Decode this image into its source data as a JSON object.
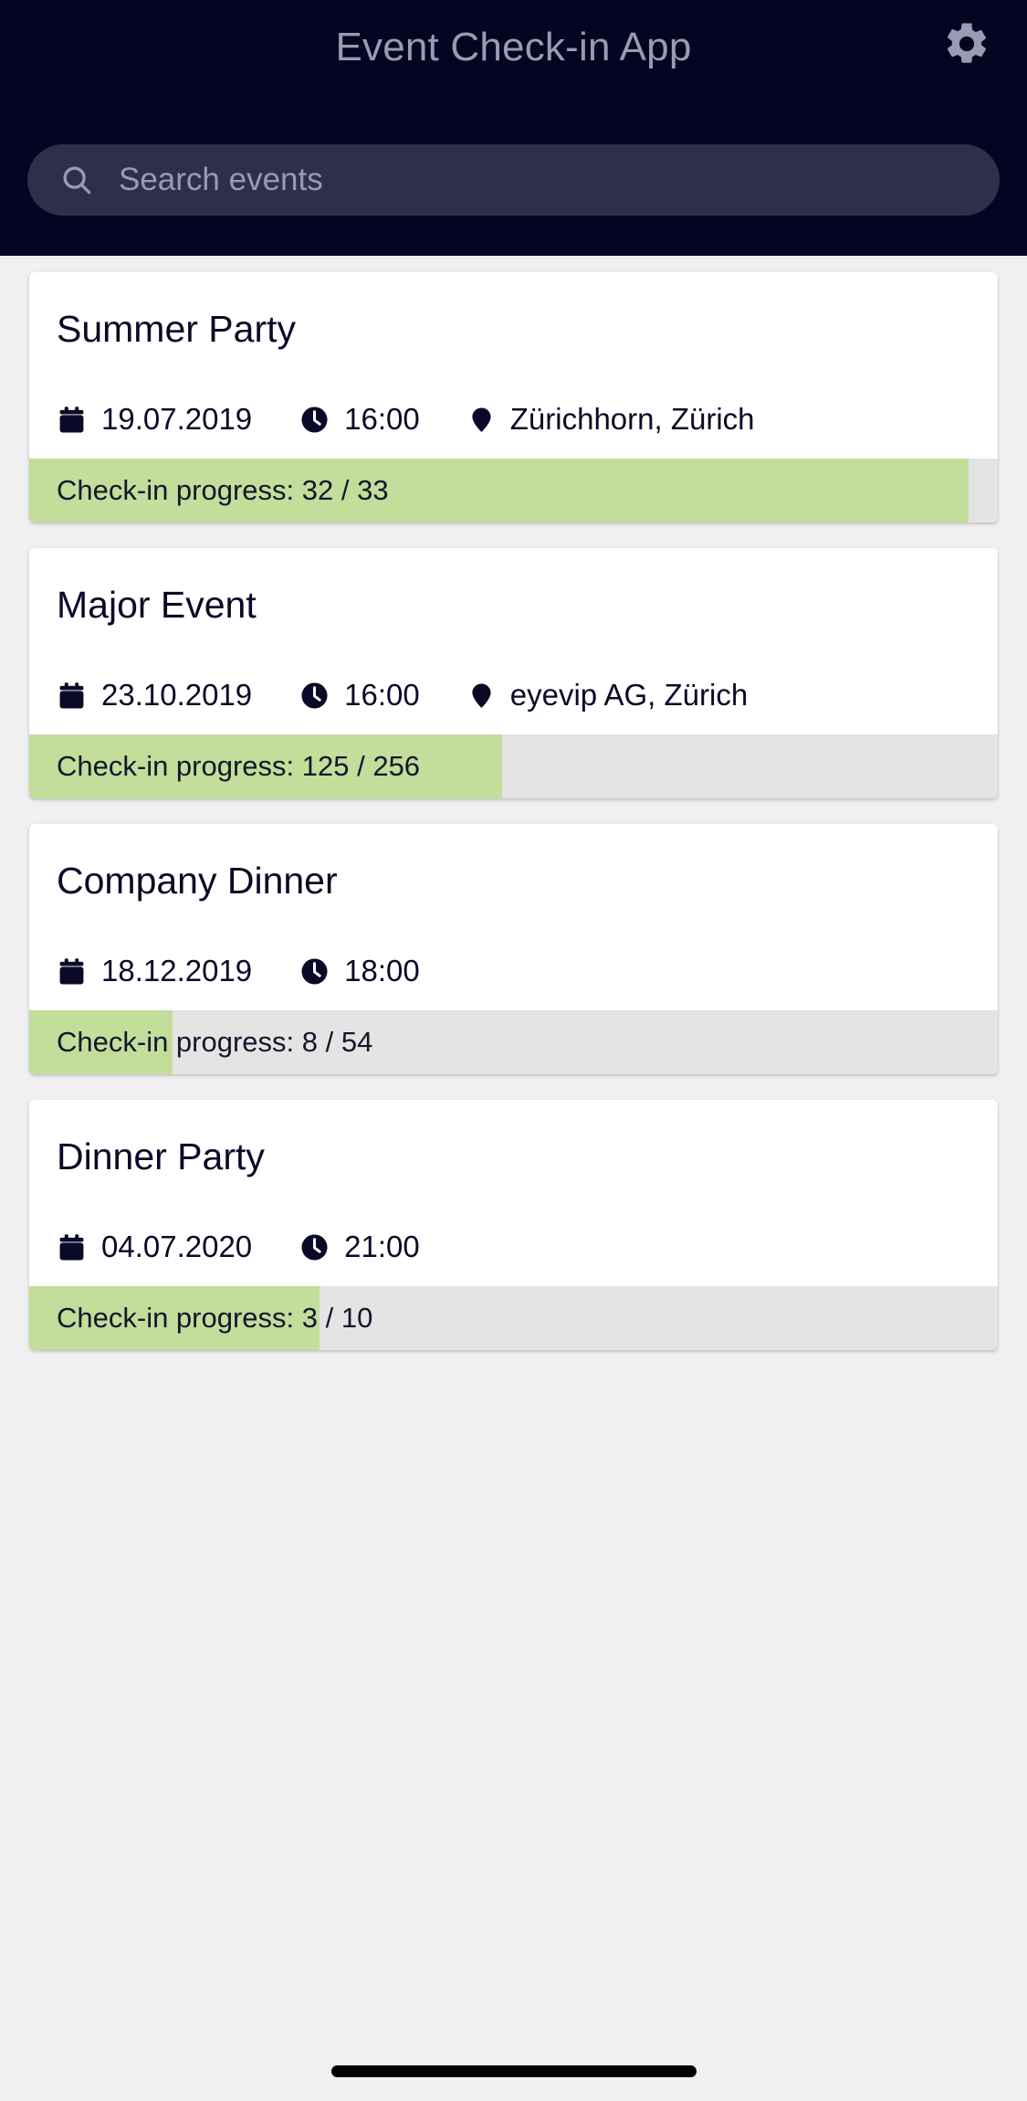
{
  "header": {
    "title": "Event Check-in App",
    "settings_icon": "gear-icon"
  },
  "search": {
    "placeholder": "Search events",
    "value": "",
    "icon": "search-icon"
  },
  "colors": {
    "appbar_bg": "#050523",
    "search_bg": "#2f2f4a",
    "page_bg": "#f0f0f2",
    "card_bg": "#ffffff",
    "progress_fill": "#c3dd9a",
    "progress_track": "#e4e4e4",
    "title_text": "#9a9ab2",
    "body_text": "#0a0a28"
  },
  "events": [
    {
      "title": "Summer Party",
      "date": "19.07.2019",
      "time": "16:00",
      "location": "Zürichhorn, Zürich",
      "progress_label": "Check-in progress: 32 / 33",
      "checked_in": 32,
      "total": 33,
      "progress_percent": 97
    },
    {
      "title": "Major Event",
      "date": "23.10.2019",
      "time": "16:00",
      "location": "eyevip AG, Zürich",
      "progress_label": "Check-in progress: 125 / 256",
      "checked_in": 125,
      "total": 256,
      "progress_percent": 48.8
    },
    {
      "title": "Company Dinner",
      "date": "18.12.2019",
      "time": "18:00",
      "location": "",
      "progress_label": "Check-in progress: 8 / 54",
      "checked_in": 8,
      "total": 54,
      "progress_percent": 14.8
    },
    {
      "title": "Dinner Party",
      "date": "04.07.2020",
      "time": "21:00",
      "location": "",
      "progress_label": "Check-in progress: 3 / 10",
      "checked_in": 3,
      "total": 10,
      "progress_percent": 30
    }
  ]
}
